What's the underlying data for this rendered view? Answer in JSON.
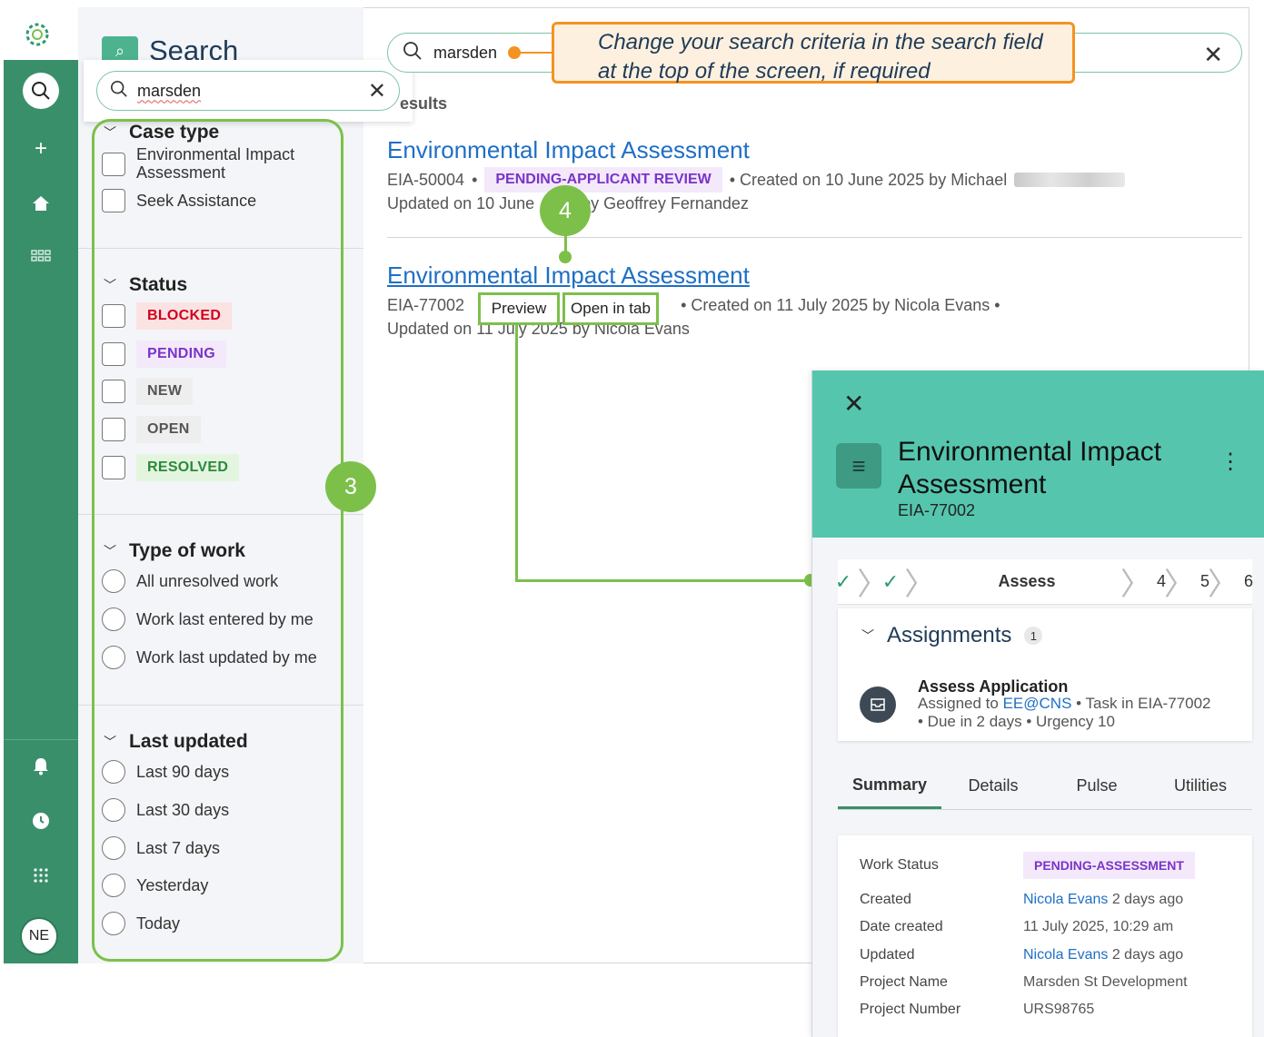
{
  "rail": {
    "avatar_initials": "NE"
  },
  "filter_panel": {
    "heading": "Search",
    "search_value": "marsden",
    "case_type": {
      "title": "Case type",
      "options": [
        "Environmental Impact Assessment",
        "Seek Assistance"
      ]
    },
    "status": {
      "title": "Status",
      "options": [
        {
          "label": "BLOCKED",
          "color": "#d0021b",
          "bg": "#fbe3e3"
        },
        {
          "label": "PENDING",
          "color": "#7a34c8",
          "bg": "#f3e9fb"
        },
        {
          "label": "NEW",
          "color": "#555555",
          "bg": "#eeeeee"
        },
        {
          "label": "OPEN",
          "color": "#555555",
          "bg": "#eeeeee"
        },
        {
          "label": "RESOLVED",
          "color": "#2a8a3a",
          "bg": "#e3f5df"
        }
      ]
    },
    "type_of_work": {
      "title": "Type of work",
      "options": [
        "All unresolved work",
        "Work last entered by me",
        "Work last updated by me"
      ]
    },
    "last_updated": {
      "title": "Last updated",
      "options": [
        "Last 90 days",
        "Last 30 days",
        "Last 7 days",
        "Yesterday",
        "Today"
      ]
    },
    "marker_number": "3"
  },
  "top_search": {
    "value": "marsden",
    "callout_text": "Change your search criteria in the search field at the top of the screen, if required"
  },
  "results": {
    "label": "esults",
    "items": [
      {
        "title": "Environmental Impact Assessment",
        "id": "EIA-50004",
        "badge": "PENDING-APPLICANT REVIEW",
        "created": "• Created on 10 June 2025 by Michael",
        "updated": "Updated on 10 June",
        "updated_rest": "by Geoffrey Fernandez"
      },
      {
        "title": "Environmental Impact Assessment",
        "id": "EIA-77002",
        "created": "• Created on 11 July 2025 by Nicola Evans •",
        "updated": "Updated on 11 July 2025 by Nicola Evans"
      }
    ],
    "marker_number": "4",
    "preview_btn": "Preview",
    "open_tab_btn": "Open in tab"
  },
  "preview": {
    "title": "Environmental Impact Assessment",
    "id": "EIA-77002",
    "stages": {
      "current": "Assess",
      "next": [
        "4",
        "5",
        "6"
      ]
    },
    "assignments": {
      "title": "Assignments",
      "count": "1",
      "task_title": "Assess Application",
      "assigned_prefix": "Assigned to",
      "assigned_to": "EE@CNS",
      "task_suffix": "• Task in EIA-77002",
      "due": "• Due in 2 days • Urgency 10"
    },
    "tabs": [
      "Summary",
      "Details",
      "Pulse",
      "Utilities"
    ],
    "summary": {
      "work_status_label": "Work Status",
      "work_status": "PENDING-ASSESSMENT",
      "created_label": "Created",
      "created_by": "Nicola Evans",
      "created_when": "2 days ago",
      "date_created_label": "Date created",
      "date_created": "11 July 2025, 10:29 am",
      "updated_label": "Updated",
      "updated_by": "Nicola Evans",
      "updated_when": "2 days ago",
      "project_name_label": "Project Name",
      "project_name": "Marsden St Development",
      "project_number_label": "Project Number",
      "project_number": "URS98765"
    }
  },
  "colors": {
    "accent_green": "#3a8f6b",
    "annotation_green": "#7cc04a",
    "callout_orange": "#f39323",
    "link_blue": "#1f6fc5"
  }
}
